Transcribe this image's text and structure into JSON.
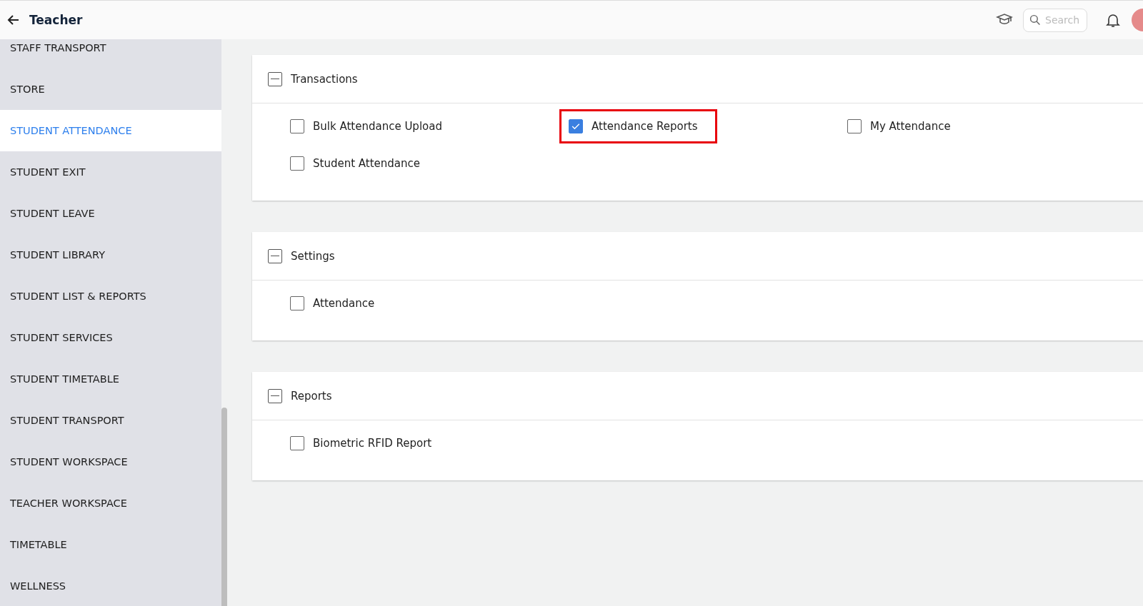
{
  "header": {
    "title": "Teacher",
    "search": {
      "placeholder": "Search"
    }
  },
  "sidebar": {
    "items": [
      {
        "label": "STAFF TRANSPORT",
        "selected": false
      },
      {
        "label": "STORE",
        "selected": false
      },
      {
        "label": "STUDENT ATTENDANCE",
        "selected": true
      },
      {
        "label": "STUDENT EXIT",
        "selected": false
      },
      {
        "label": "STUDENT LEAVE",
        "selected": false
      },
      {
        "label": "STUDENT LIBRARY",
        "selected": false
      },
      {
        "label": "STUDENT LIST & REPORTS",
        "selected": false
      },
      {
        "label": "STUDENT SERVICES",
        "selected": false
      },
      {
        "label": "STUDENT TIMETABLE",
        "selected": false
      },
      {
        "label": "STUDENT TRANSPORT",
        "selected": false
      },
      {
        "label": "STUDENT WORKSPACE",
        "selected": false
      },
      {
        "label": "TEACHER WORKSPACE",
        "selected": false
      },
      {
        "label": "TIMETABLE",
        "selected": false
      },
      {
        "label": "WELLNESS",
        "selected": false
      }
    ]
  },
  "sections": [
    {
      "title": "Transactions",
      "expanded": true,
      "items": [
        {
          "label": "Bulk Attendance Upload",
          "checked": false,
          "highlighted": false
        },
        {
          "label": "Attendance Reports",
          "checked": true,
          "highlighted": true
        },
        {
          "label": "My Attendance",
          "checked": false,
          "highlighted": false
        },
        {
          "label": "Student Attendance",
          "checked": false,
          "highlighted": false
        }
      ]
    },
    {
      "title": "Settings",
      "expanded": true,
      "items": [
        {
          "label": "Attendance",
          "checked": false,
          "highlighted": false
        }
      ]
    },
    {
      "title": "Reports",
      "expanded": true,
      "items": [
        {
          "label": "Biometric RFID Report",
          "checked": false,
          "highlighted": false
        }
      ]
    }
  ]
}
